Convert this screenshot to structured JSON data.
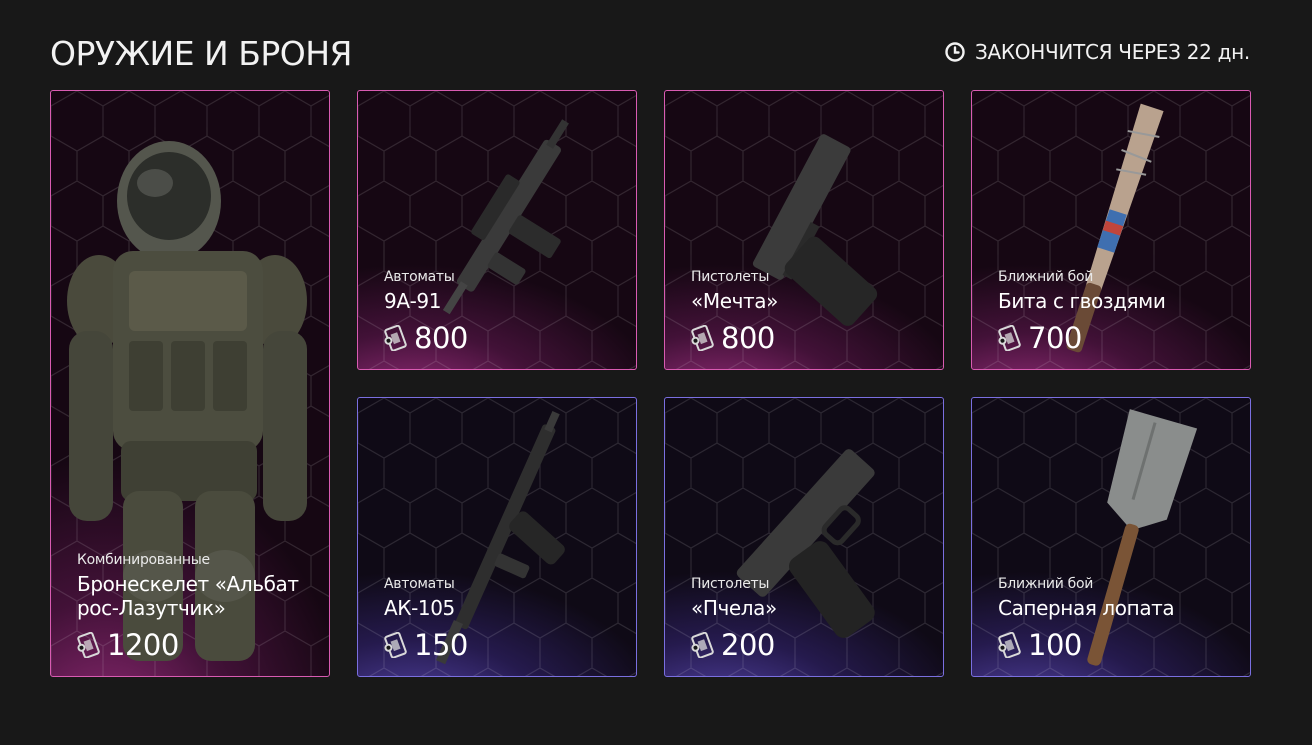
{
  "header": {
    "title": "ОРУЖИЕ И БРОНЯ",
    "timer_icon": "clock-icon",
    "timer_text": "ЗАКОНЧИТСЯ ЧЕРЕЗ 22 дн."
  },
  "colors": {
    "pink_border": "#d95bb2",
    "blue_border": "#7a6fe0",
    "background": "#181818"
  },
  "items": [
    {
      "category": "Комбинированные",
      "name_line1": "Бронескелет «Альбат",
      "name_line2": "рос-Лазутчик»",
      "price": "1200",
      "currency_icon": "coupon-icon",
      "image": "armor-exoskeleton"
    },
    {
      "category": "Автоматы",
      "name_line1": "9А-91",
      "price": "800",
      "currency_icon": "coupon-icon",
      "image": "smg-9a91"
    },
    {
      "category": "Пистолеты",
      "name_line1": "«Мечта»",
      "price": "800",
      "currency_icon": "coupon-icon",
      "image": "pistol"
    },
    {
      "category": "Ближний бой",
      "name_line1": "Бита с гвоздями",
      "price": "700",
      "currency_icon": "coupon-icon",
      "image": "nail-bat"
    },
    {
      "category": "Автоматы",
      "name_line1": "АК-105",
      "price": "150",
      "currency_icon": "coupon-icon",
      "image": "rifle-ak105"
    },
    {
      "category": "Пистолеты",
      "name_line1": "«Пчела»",
      "price": "200",
      "currency_icon": "coupon-icon",
      "image": "pistol"
    },
    {
      "category": "Ближний бой",
      "name_line1": "Саперная лопата",
      "price": "100",
      "currency_icon": "coupon-icon",
      "image": "shovel"
    }
  ]
}
